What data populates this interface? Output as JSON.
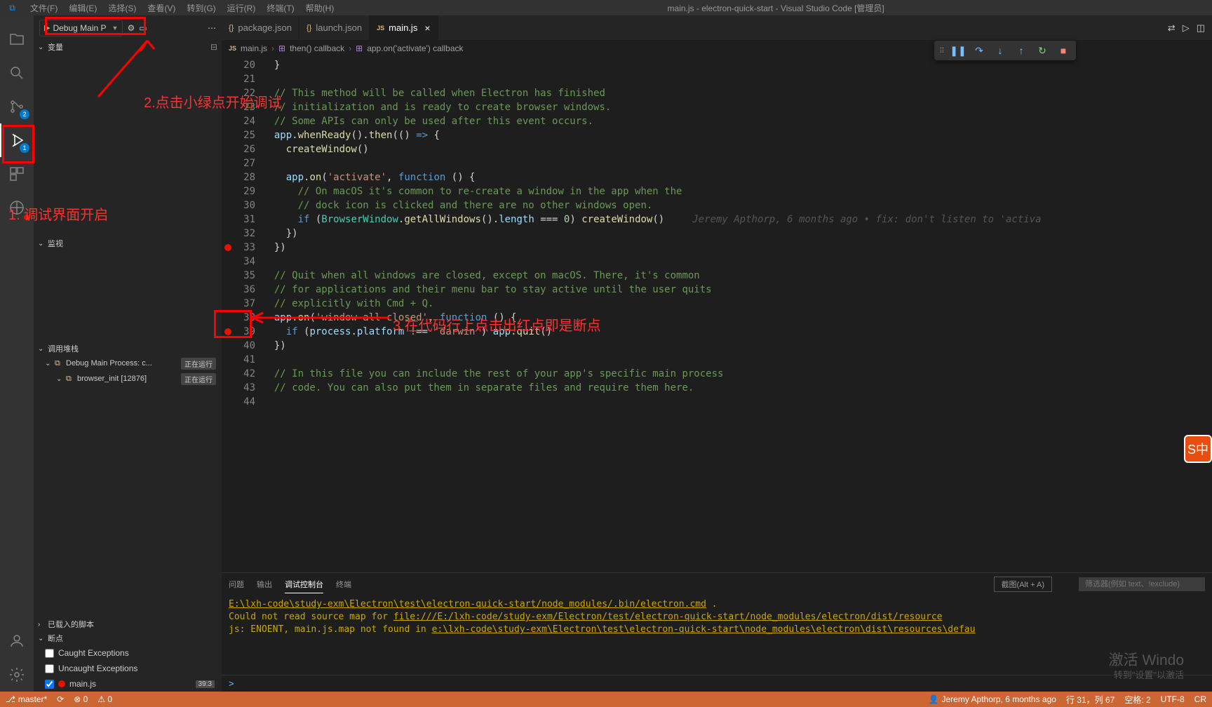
{
  "titleBar": {
    "menu": [
      "文件(F)",
      "编辑(E)",
      "选择(S)",
      "查看(V)",
      "转到(G)",
      "运行(R)",
      "终端(T)",
      "帮助(H)"
    ],
    "title": "main.js - electron-quick-start - Visual Studio Code [管理员]"
  },
  "activityBar": {
    "scmBadge": "2",
    "debugBadge": "1"
  },
  "debugSidebar": {
    "configName": "Debug Main P",
    "sections": {
      "variables": "变量",
      "watch": "监视",
      "callstack": "调用堆栈",
      "loadedScripts": "已载入的脚本",
      "breakpoints": "断点"
    },
    "callstack": [
      {
        "name": "Debug Main Process: c...",
        "state": "正在运行",
        "hasIcon": true
      },
      {
        "name": "browser_init [12876]",
        "state": "正在运行",
        "hasIcon": true
      }
    ],
    "breakpoints": {
      "caught": "Caught Exceptions",
      "uncaught": "Uncaught Exceptions",
      "file": "main.js",
      "filePos": "39:3"
    }
  },
  "tabs": [
    {
      "icon": "{}",
      "label": "package.json",
      "iconClass": "json-brace"
    },
    {
      "icon": "{}",
      "label": "launch.json",
      "iconClass": "json-brace"
    },
    {
      "icon": "JS",
      "label": "main.js",
      "iconClass": "js",
      "active": true
    }
  ],
  "breadcrumb": {
    "parts": [
      {
        "icon": "JS",
        "label": "main.js"
      },
      {
        "icon": "⊞",
        "label": "then() callback"
      },
      {
        "icon": "⊞",
        "label": "app.on('activate') callback"
      }
    ]
  },
  "code": {
    "startLine": 20,
    "lines": [
      {
        "n": 20,
        "html": "<span class='tok-plain'>  }</span>"
      },
      {
        "n": 21,
        "html": ""
      },
      {
        "n": 22,
        "html": "  <span class='tok-comment'>// This method will be called when Electron has finished</span>"
      },
      {
        "n": 23,
        "html": "  <span class='tok-comment'>// initialization and is ready to create browser windows.</span>"
      },
      {
        "n": 24,
        "html": "  <span class='tok-comment'>// Some APIs can only be used after this event occurs.</span>"
      },
      {
        "n": 25,
        "html": "  <span class='tok-var'>app</span><span class='tok-plain'>.</span><span class='tok-func'>whenReady</span><span class='tok-plain'>().</span><span class='tok-func'>then</span><span class='tok-plain'>(() </span><span class='tok-keyword'>=&gt;</span><span class='tok-plain'> {</span>"
      },
      {
        "n": 26,
        "html": "    <span class='tok-func'>createWindow</span><span class='tok-plain'>()</span>"
      },
      {
        "n": 27,
        "html": ""
      },
      {
        "n": 28,
        "html": "    <span class='tok-var'>app</span><span class='tok-plain'>.</span><span class='tok-func'>on</span><span class='tok-plain'>(</span><span class='tok-string'>'activate'</span><span class='tok-plain'>, </span><span class='tok-keyword'>function</span><span class='tok-plain'> () {</span>"
      },
      {
        "n": 29,
        "html": "      <span class='tok-comment'>// On macOS it's common to re-create a window in the app when the</span>"
      },
      {
        "n": 30,
        "html": "      <span class='tok-comment'>// dock icon is clicked and there are no other windows open.</span>"
      },
      {
        "n": 31,
        "html": "      <span class='tok-keyword'>if</span><span class='tok-plain'> (</span><span class='tok-type'>BrowserWindow</span><span class='tok-plain'>.</span><span class='tok-func'>getAllWindows</span><span class='tok-plain'>().</span><span class='tok-var'>length</span><span class='tok-plain'> === </span><span class='tok-num'>0</span><span class='tok-plain'>) </span><span class='tok-func'>createWindow</span><span class='tok-plain'>()</span><span class='tok-blame'>Jeremy Apthorp, 6 months ago • fix: don't listen to 'activa</span>"
      },
      {
        "n": 32,
        "html": "    <span class='tok-plain'>})</span>"
      },
      {
        "n": 33,
        "html": "  <span class='tok-plain'>})</span>",
        "bp": true
      },
      {
        "n": 34,
        "html": ""
      },
      {
        "n": 35,
        "html": "  <span class='tok-comment'>// Quit when all windows are closed, except on macOS. There, it's common</span>"
      },
      {
        "n": 36,
        "html": "  <span class='tok-comment'>// for applications and their menu bar to stay active until the user quits</span>"
      },
      {
        "n": 37,
        "html": "  <span class='tok-comment'>// explicitly with Cmd + Q.</span>"
      },
      {
        "n": 38,
        "html": "  <span class='tok-var'>app</span><span class='tok-plain'>.</span><span class='tok-func'>on</span><span class='tok-plain'>(</span><span class='tok-string'>'window-all-closed'</span><span class='tok-plain'>, </span><span class='tok-keyword'>function</span><span class='tok-plain'> () {</span>"
      },
      {
        "n": 39,
        "html": "    <span class='tok-keyword'>if</span><span class='tok-plain'> (</span><span class='tok-var'>process</span><span class='tok-plain'>.</span><span class='tok-var'>platform</span><span class='tok-plain'> !== </span><span class='tok-string'>'darwin'</span><span class='tok-plain'>) </span><span class='tok-var'>app</span><span class='tok-plain'>.</span><span class='tok-func'>quit</span><span class='tok-plain'>()</span>",
        "bp": true
      },
      {
        "n": 40,
        "html": "  <span class='tok-plain'>})</span>"
      },
      {
        "n": 41,
        "html": ""
      },
      {
        "n": 42,
        "html": "  <span class='tok-comment'>// In this file you can include the rest of your app's specific main process</span>"
      },
      {
        "n": 43,
        "html": "  <span class='tok-comment'>// code. You can also put them in separate files and require them here.</span>"
      },
      {
        "n": 44,
        "html": ""
      }
    ]
  },
  "panel": {
    "tabs": {
      "problems": "问题",
      "output": "输出",
      "debugConsole": "调试控制台",
      "terminal": "终端"
    },
    "snipHint": "截图(Alt + A)",
    "filterPlaceholder": "筛选器(例如 text、!exclude)",
    "line1_path": "E:\\lxh-code\\study-exm\\Electron\\test\\electron-quick-start/node_modules/.bin/electron.cmd",
    "line1_suffix": " .",
    "line2_prefix": "Could not read source map for ",
    "line2_link": "file:///E:/lxh-code/study-exm/Electron/test/electron-quick-start/node_modules/electron/dist/resource",
    "line3_prefix": "js: ENOENT, main.js.map not found in ",
    "line3_link": "e:\\lxh-code\\study-exm\\Electron\\test\\electron-quick-start\\node_modules\\electron\\dist\\resources\\defau"
  },
  "statusBar": {
    "branch": "master*",
    "sync": "⟳",
    "errors": "⊗ 0",
    "warnings": "⚠ 0",
    "blame": "Jeremy Apthorp, 6 months ago",
    "pos": "行 31，列 67",
    "spaces": "空格: 2",
    "encoding": "UTF-8",
    "eol": "CR"
  },
  "annotations": {
    "a1": "1.    调试界面开启",
    "a2": "2.点击小绿点开始调试",
    "a3": "3.在代码行上点击出红点即是断点"
  },
  "watermark": {
    "line1": "激活 Windo",
    "line2": "转到\"设置\"以激活"
  },
  "ime": "S中"
}
